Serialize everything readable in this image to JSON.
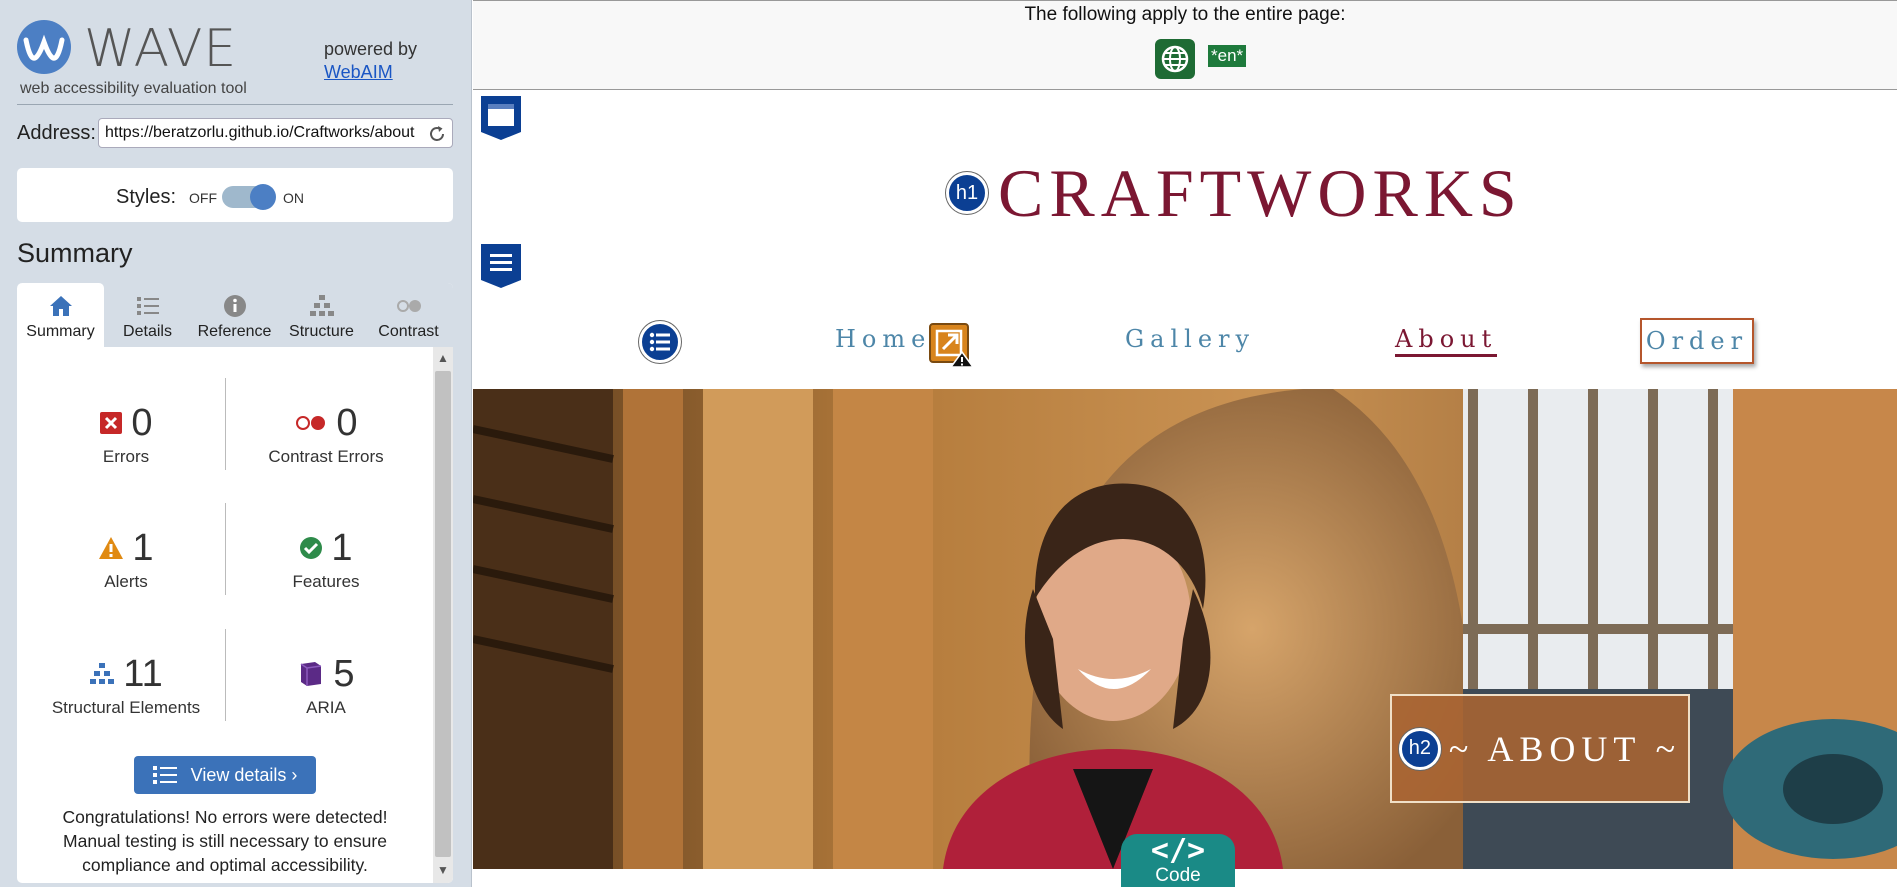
{
  "sidebar": {
    "logo_text": "WAVE",
    "tagline": "web accessibility evaluation tool",
    "powered_by": "powered by",
    "powered_link": "WebAIM",
    "address_label": "Address:",
    "address_value": "https://beratzorlu.github.io/Craftworks/about",
    "styles_label": "Styles:",
    "styles_off": "OFF",
    "styles_on": "ON",
    "summary_heading": "Summary",
    "tabs": [
      {
        "label": "Summary",
        "icon": "home-icon",
        "active": true
      },
      {
        "label": "Details",
        "icon": "list-icon",
        "active": false
      },
      {
        "label": "Reference",
        "icon": "info-icon",
        "active": false
      },
      {
        "label": "Structure",
        "icon": "hierarchy-icon",
        "active": false
      },
      {
        "label": "Contrast",
        "icon": "contrast-icon",
        "active": false
      }
    ],
    "stats": {
      "errors": {
        "count": "0",
        "label": "Errors"
      },
      "contrast": {
        "count": "0",
        "label": "Contrast Errors"
      },
      "alerts": {
        "count": "1",
        "label": "Alerts"
      },
      "features": {
        "count": "1",
        "label": "Features"
      },
      "structural": {
        "count": "11",
        "label": "Structural Elements"
      },
      "aria": {
        "count": "5",
        "label": "ARIA"
      }
    },
    "view_details": "View details ›",
    "congrats": "Congratulations! No errors were detected! Manual testing is still necessary to ensure compliance and optimal accessibility."
  },
  "page": {
    "top_notice": "The following apply to the entire page:",
    "lang_badge": "*en*",
    "h1_badge": "h1",
    "site_title": "CRAFTWORKS",
    "nav": {
      "home": "Home",
      "gallery": "Gallery",
      "about": "About",
      "order": "Order"
    },
    "h2_badge": "h2",
    "about_heading": "~ ABOUT ~",
    "code_symbol": "</>",
    "code_label": "Code"
  },
  "colors": {
    "sidebar_bg": "#d5dde6",
    "wave_blue": "#3b72b9",
    "title_maroon": "#7b1732",
    "nav_blue": "#4d86a8",
    "code_teal": "#1a8a86"
  }
}
